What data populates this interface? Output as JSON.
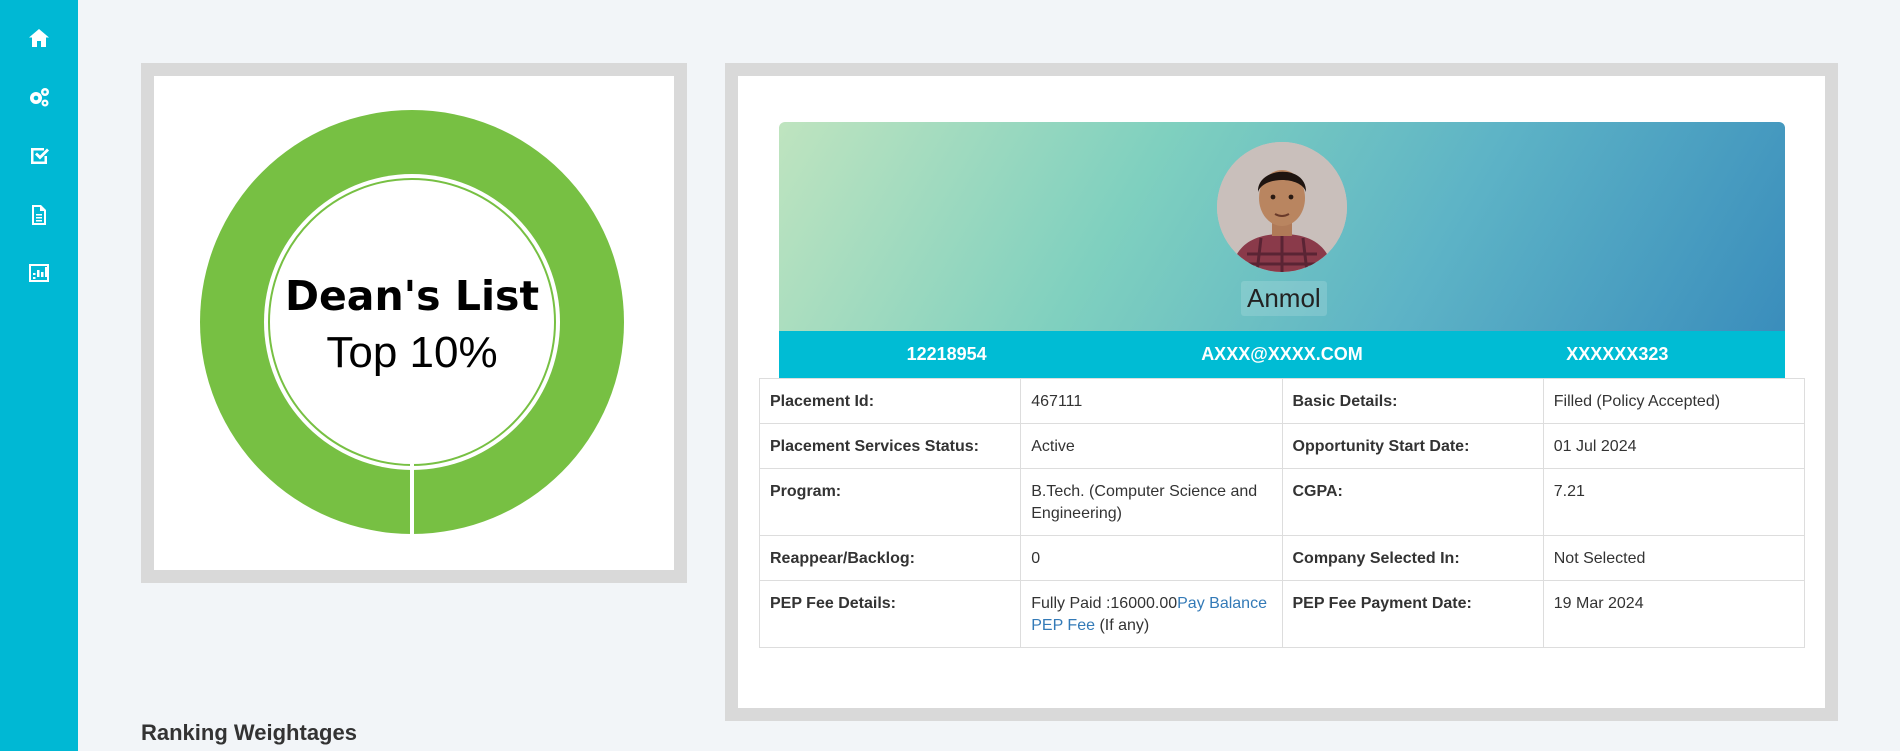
{
  "sidebar": {
    "items": [
      {
        "icon": "home-icon"
      },
      {
        "icon": "settings-icon"
      },
      {
        "icon": "checklist-icon"
      },
      {
        "icon": "document-icon"
      },
      {
        "icon": "chart-icon"
      }
    ]
  },
  "badge": {
    "title": "Dean's List",
    "subtitle": "Top 10%",
    "ring_color": "#77c043"
  },
  "profile": {
    "name": "Anmol",
    "registration": "12218954",
    "email": "AXXX@XXXX.COM",
    "phone": "XXXXXX323"
  },
  "details": {
    "placement_id_label": "Placement Id:",
    "placement_id": "467111",
    "basic_details_label": "Basic Details:",
    "basic_details": "Filled (Policy Accepted)",
    "placement_status_label": "Placement Services Status:",
    "placement_status": "Active",
    "opportunity_start_label": "Opportunity Start Date:",
    "opportunity_start": "01 Jul 2024",
    "program_label": "Program:",
    "program": "B.Tech. (Computer Science and Engineering)",
    "cgpa_label": "CGPA:",
    "cgpa": "7.21",
    "backlog_label": "Reappear/Backlog:",
    "backlog": "0",
    "company_label": "Company Selected In:",
    "company": "Not Selected",
    "pep_fee_label": "PEP Fee Details:",
    "pep_fee_text": "Fully Paid :16000.00",
    "pep_fee_link": "Pay Balance PEP Fee",
    "pep_fee_suffix": " (If any)",
    "pep_payment_date_label": "PEP Fee Payment Date:",
    "pep_payment_date": "19 Mar 2024"
  },
  "section": {
    "ranking_title": "Ranking Weightages"
  }
}
